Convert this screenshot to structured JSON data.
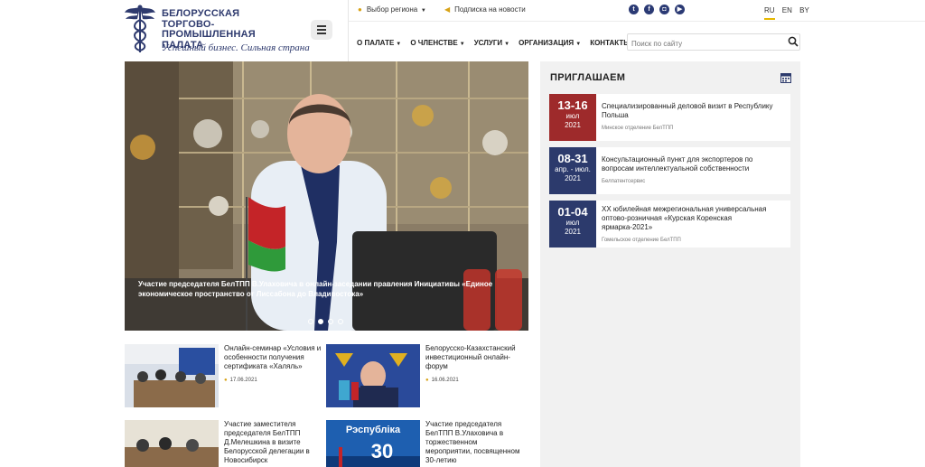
{
  "logo": {
    "title_line1": "БЕЛОРУССКАЯ",
    "title_line2": "ТОРГОВО-ПРОМЫШЛЕННАЯ",
    "title_line3": "ПАЛАТА",
    "slogan": "Успешный бизнес. Сильная страна"
  },
  "topbar": {
    "region_label": "Выбор региона",
    "subscribe_label": "Подписка на новости",
    "social": [
      "twitter-icon",
      "facebook-icon",
      "instagram-icon",
      "youtube-icon"
    ],
    "languages": [
      "RU",
      "EN",
      "BY"
    ],
    "active_language": "RU"
  },
  "nav": {
    "items": [
      {
        "label": "О ПАЛАТЕ",
        "dropdown": true
      },
      {
        "label": "О ЧЛЕНСТВЕ",
        "dropdown": true
      },
      {
        "label": "УСЛУГИ",
        "dropdown": true
      },
      {
        "label": "ОРГАНИЗАЦИЯ",
        "dropdown": true
      },
      {
        "label": "КОНТАКТЫ",
        "dropdown": false
      }
    ],
    "search_placeholder": "Поиск по сайту"
  },
  "hero": {
    "caption": "Участие председателя БелТПП В.Улаховича в онлайн-заседании правления Инициативы «Единое экономическое пространство от Лиссабона до Владивостока»",
    "slides": 4,
    "active_slide": 2
  },
  "news": [
    {
      "title": "Онлайн-семинар «Условия и особенности получения сертификата «Халяль»",
      "date": "17.06.2021"
    },
    {
      "title": "Белорусско-Казахстанский инвестиционный онлайн-форум",
      "date": "16.06.2021"
    },
    {
      "title": "Участие заместителя председателя БелТПП Д.Мелешкина в визите Белорусской делегации в Новосибирск",
      "date": ""
    },
    {
      "title": "Участие председателя БелТПП В.Улаховича в торжественном мероприятии, посвященном 30-летию",
      "date": ""
    }
  ],
  "invite": {
    "title": "ПРИГЛАШАЕМ",
    "events": [
      {
        "range": "13-16",
        "month": "июл",
        "year": "2021",
        "title": "Специализированный деловой визит в Республику Польша",
        "org": "Минское отделение БелТПП",
        "color": "#9e2a2b"
      },
      {
        "range": "08-31",
        "month": "апр. - июл.",
        "year": "2021",
        "title": "Консультационный пункт для экспортеров по вопросам интеллектуальной собственности",
        "org": "Белпатентсервис",
        "color": "#2c3a6c"
      },
      {
        "range": "01-04",
        "month": "июл",
        "year": "2021",
        "title": "XX юбилейная межрегиональная универсальная оптово-розничная «Курская Коренская ярмарка-2021»",
        "org": "Гомельское отделение БелТПП",
        "color": "#2c3a6c"
      }
    ]
  },
  "colors": {
    "brand_navy": "#2e3a6e",
    "accent_gold": "#d8a317",
    "event_red": "#9e2a2b",
    "event_navy": "#2c3a6c"
  }
}
